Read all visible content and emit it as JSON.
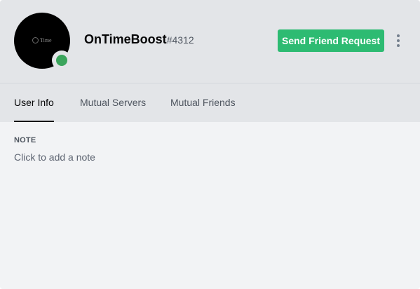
{
  "profile": {
    "username": "OnTimeBoost",
    "discriminator": "#4312",
    "avatar_logo_text": "Time",
    "status": "online",
    "status_color": "#3ba55c"
  },
  "actions": {
    "send_friend_request_label": "Send Friend Request",
    "send_button_color": "#2dbb72",
    "more_icon": "more-vertical-icon"
  },
  "tabs": [
    {
      "label": "User Info",
      "active": true
    },
    {
      "label": "Mutual Servers",
      "active": false
    },
    {
      "label": "Mutual Friends",
      "active": false
    }
  ],
  "note": {
    "heading": "NOTE",
    "placeholder": "Click to add a note"
  }
}
